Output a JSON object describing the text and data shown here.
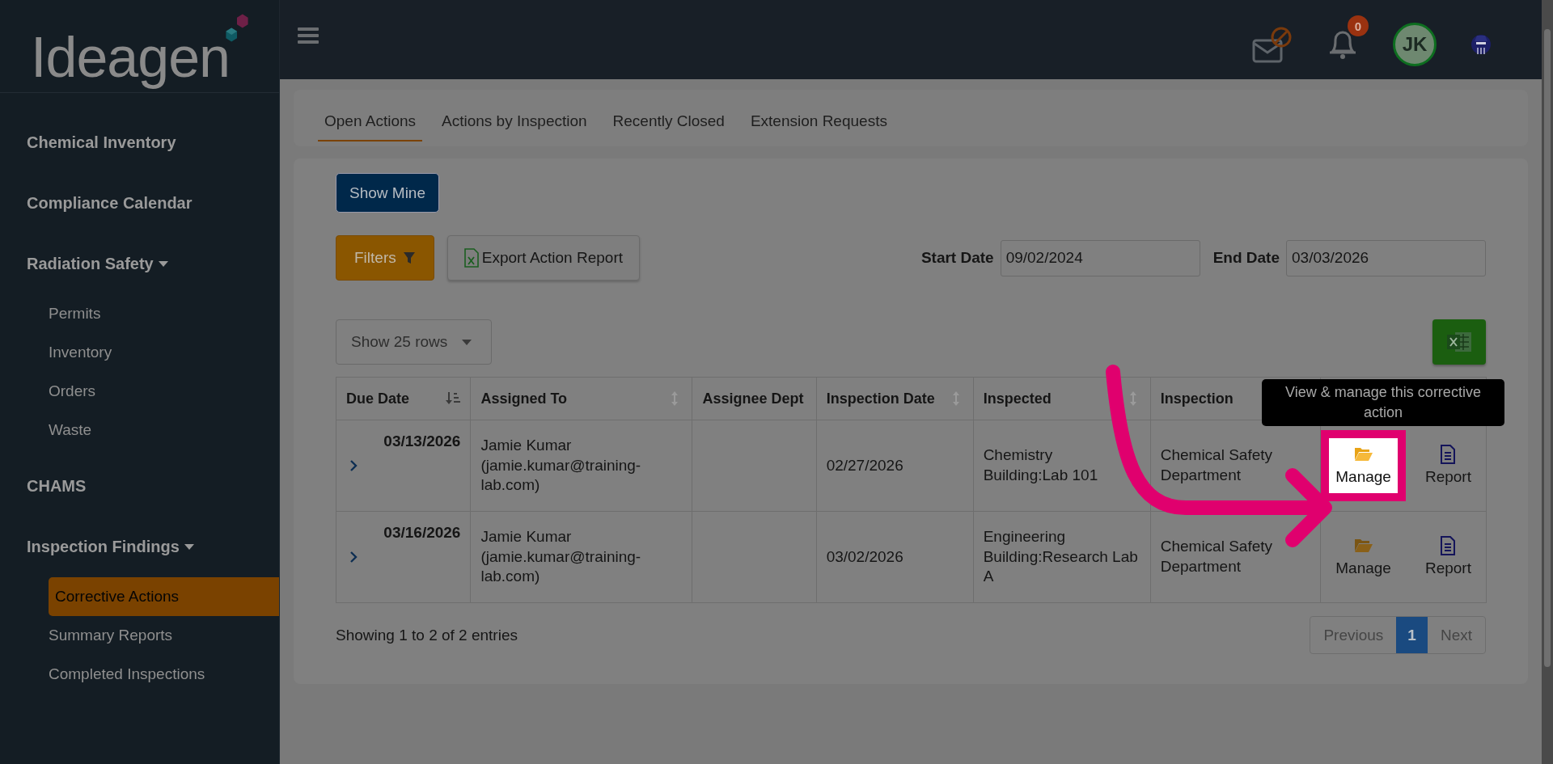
{
  "brand": {
    "name": "Ideagen"
  },
  "top_bar": {
    "notification_count": "0",
    "avatar_initials": "JK"
  },
  "sidebar": {
    "items": [
      {
        "label": "Chemical Inventory",
        "kind": "section"
      },
      {
        "label": "Compliance Calendar",
        "kind": "section"
      },
      {
        "label": "Radiation Safety",
        "kind": "group",
        "expanded": true,
        "children": [
          {
            "label": "Permits",
            "selected": false
          },
          {
            "label": "Inventory",
            "selected": false
          },
          {
            "label": "Orders",
            "selected": false
          },
          {
            "label": "Waste",
            "selected": false
          }
        ]
      },
      {
        "label": "CHAMS",
        "kind": "section"
      },
      {
        "label": "Inspection Findings",
        "kind": "group",
        "expanded": true,
        "children": [
          {
            "label": "Corrective Actions",
            "selected": true
          },
          {
            "label": "Summary Reports",
            "selected": false
          },
          {
            "label": "Completed Inspections",
            "selected": false
          }
        ]
      }
    ]
  },
  "tabs": [
    {
      "label": "Open Actions",
      "selected": true
    },
    {
      "label": "Actions by Inspection",
      "selected": false
    },
    {
      "label": "Recently Closed",
      "selected": false
    },
    {
      "label": "Extension Requests",
      "selected": false
    }
  ],
  "show_mine_button": "Show Mine",
  "filters_button": "Filters",
  "export_button": "Export Action Report",
  "start_date": {
    "label": "Start Date",
    "value": "09/02/2024"
  },
  "end_date": {
    "label": "End Date",
    "value": "03/03/2026"
  },
  "rows_select": "Show 25 rows",
  "table": {
    "columns": [
      {
        "label": "Due Date",
        "kind": "sorted"
      },
      {
        "label": "Assigned To",
        "kind": "sortable"
      },
      {
        "label": "Assignee Dept",
        "kind": "plain"
      },
      {
        "label": "Inspection Date",
        "kind": "sortable"
      },
      {
        "label": "Inspected",
        "kind": "sortable"
      },
      {
        "label": "Inspection",
        "kind": "plain"
      },
      {
        "kind": "plain"
      }
    ],
    "rows": [
      {
        "due_date": "03/13/2026",
        "assigned_to": "Jamie Kumar (jamie.kumar@training-lab.com)",
        "inspection_date": "02/27/2026",
        "inspected": "Chemistry Building:Lab 101",
        "inspection_dept": "Chemical Safety Department",
        "actions": [
          {
            "label": "Manage",
            "kind": "manage",
            "highlighted": true
          },
          {
            "label": "Report",
            "kind": "report",
            "highlighted": false
          }
        ]
      },
      {
        "due_date": "03/16/2026",
        "assigned_to": "Jamie Kumar (jamie.kumar@training-lab.com)",
        "inspection_date": "03/02/2026",
        "inspected": "Engineering Building:Research Lab A",
        "inspection_dept": "Chemical Safety Department",
        "actions": [
          {
            "label": "Manage",
            "kind": "manage",
            "highlighted": false
          },
          {
            "label": "Report",
            "kind": "report",
            "highlighted": false
          }
        ]
      }
    ]
  },
  "info": "Showing 1 to 2 of 2 entries",
  "pagination": [
    {
      "label": "Previous",
      "kind": "prev",
      "selected": false
    },
    {
      "label": "1",
      "kind": "page",
      "selected": true
    },
    {
      "label": "Next",
      "kind": "next",
      "selected": false
    }
  ],
  "tooltip": "View & manage this corrective action"
}
